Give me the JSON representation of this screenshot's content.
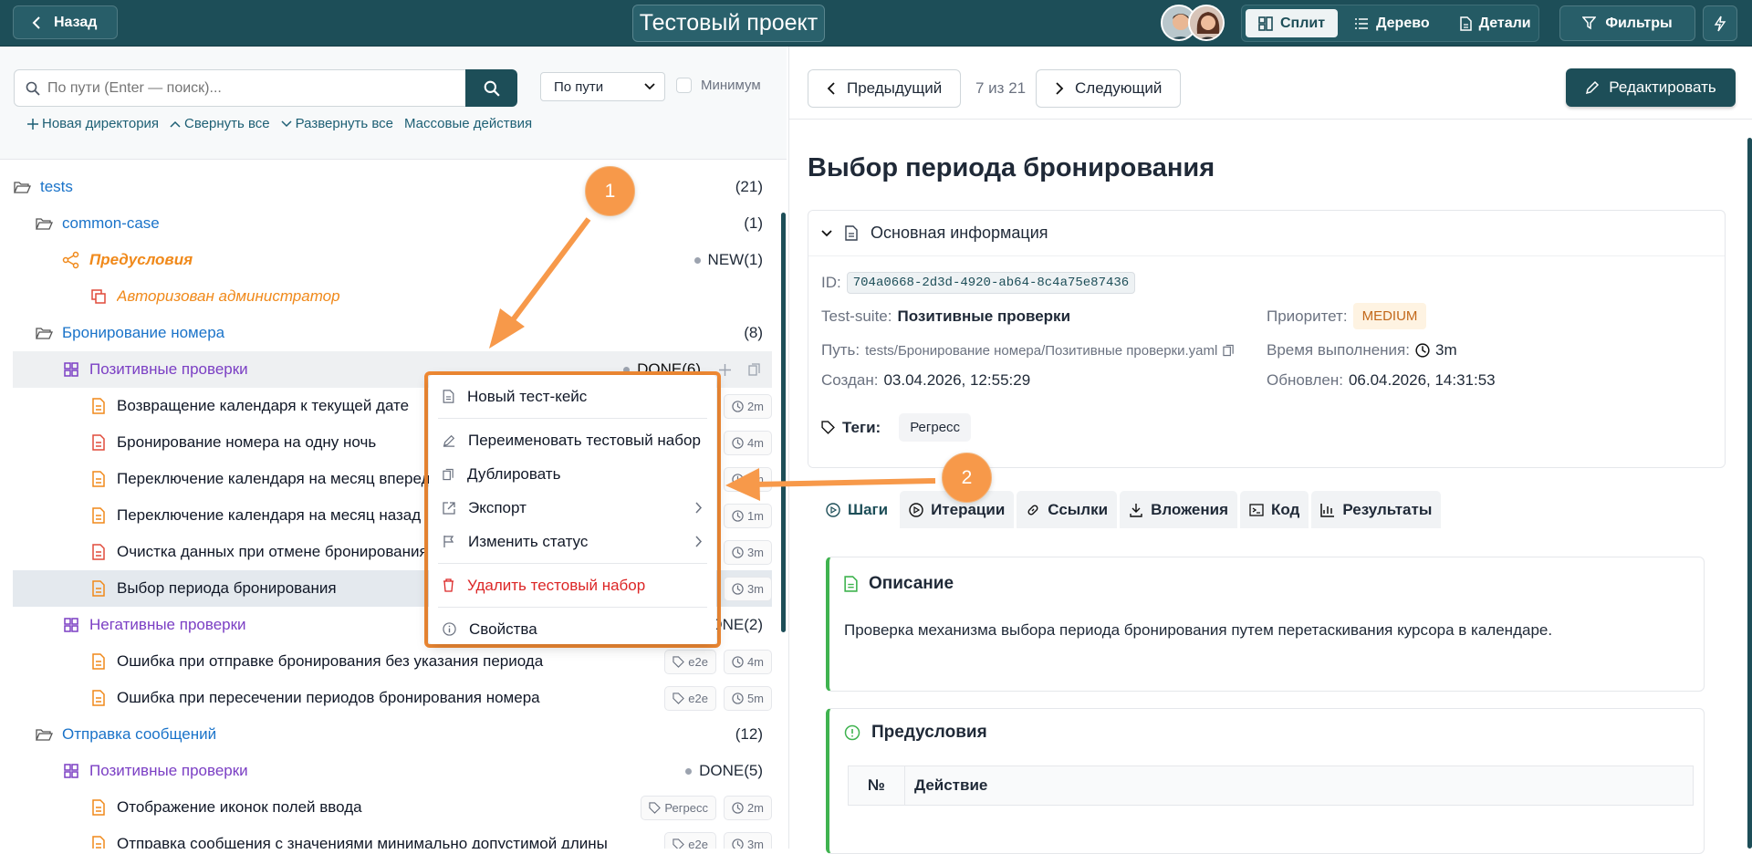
{
  "topbar": {
    "back_label": "Назад",
    "project_title": "Тестовый проект",
    "views": [
      {
        "label": "Сплит",
        "icon": "split-icon",
        "active": true
      },
      {
        "label": "Дерево",
        "icon": "list-icon",
        "active": false
      },
      {
        "label": "Детали",
        "icon": "document-icon",
        "active": false
      }
    ],
    "filters_label": "Фильтры",
    "accent": "#1d4e58"
  },
  "left": {
    "search_placeholder": "По пути (Enter — поиск)...",
    "select_value": "По пути",
    "minimum_label": "Минимум",
    "actions": {
      "new_dir": "Новая директория",
      "collapse_all": "Свернуть все",
      "expand_all": "Развернуть все",
      "bulk": "Массовые действия"
    },
    "tree": [
      {
        "name": "tests",
        "count": "(21)",
        "type": "dir"
      },
      {
        "name": "common-case",
        "count": "(1)",
        "type": "dir"
      },
      {
        "name": "Предусловия",
        "status": "NEW",
        "status_count": "(1)",
        "type": "pre"
      },
      {
        "name": "Авторизован администратор",
        "type": "pre-case"
      },
      {
        "name": "Бронирование номера",
        "count": "(8)",
        "type": "dir"
      },
      {
        "name": "Позитивные проверки",
        "status": "DONE",
        "status_count": "(6)",
        "type": "suite"
      },
      {
        "name": "Возвращение календаря к текущей дате",
        "time": "2m",
        "type": "case"
      },
      {
        "name": "Бронирование номера на одну ночь",
        "time": "4m",
        "type": "case"
      },
      {
        "name": "Переключение календаря на месяц вперед",
        "time": "1m",
        "type": "case"
      },
      {
        "name": "Переключение календаря на месяц назад",
        "time": "1m",
        "type": "case"
      },
      {
        "name": "Очистка данных при отмене бронирования",
        "time": "3m",
        "type": "case"
      },
      {
        "name": "Выбор периода бронирования",
        "time": "3m",
        "type": "case"
      },
      {
        "name": "Негативные проверки",
        "status": "DONE",
        "status_count": "(2)",
        "type": "suite"
      },
      {
        "name": "Ошибка при отправке бронирования без указания периода",
        "tag": "e2e",
        "time": "4m",
        "type": "case"
      },
      {
        "name": "Ошибка при пересечении периодов бронирования номера",
        "tag": "e2e",
        "time": "5m",
        "type": "case"
      },
      {
        "name": "Отправка сообщений",
        "count": "(12)",
        "type": "dir"
      },
      {
        "name": "Позитивные проверки",
        "status": "DONE",
        "status_count": "(5)",
        "type": "suite"
      },
      {
        "name": "Отображение иконок полей ввода",
        "tag": "Регресс",
        "time": "2m",
        "type": "case"
      },
      {
        "name": "Отправка сообщения с значениями минимально допустимой длины",
        "tag": "e2e",
        "time": "3m",
        "type": "case"
      }
    ]
  },
  "context_menu": {
    "new_case": "Новый тест-кейс",
    "rename": "Переименовать тестовый набор",
    "duplicate": "Дублировать",
    "export": "Экспорт",
    "change_status": "Изменить статус",
    "delete": "Удалить тестовый набор",
    "properties": "Свойства"
  },
  "annotations": {
    "badge1": "1",
    "badge2": "2",
    "color": "#f28a33"
  },
  "right": {
    "prev_label": "Предыдущий",
    "position": "7 из 21",
    "next_label": "Следующий",
    "edit_label": "Редактировать",
    "title": "Выбор периода бронирования",
    "info_header": "Основная информация",
    "id_label": "ID:",
    "id_value": "704a0668-2d3d-4920-ab64-8c4a75e87436",
    "suite_label": "Test-suite:",
    "suite_value": "Позитивные проверки",
    "priority_label": "Приоритет:",
    "priority_value": "MEDIUM",
    "path_label": "Путь:",
    "path_value": "tests/Бронирование номера/Позитивные проверки.yaml",
    "duration_label": "Время выполнения:",
    "duration_value": "3m",
    "created_label": "Создан:",
    "created_value": "03.04.2026, 12:55:29",
    "updated_label": "Обновлен:",
    "updated_value": "06.04.2026, 14:31:53",
    "tags_label": "Теги:",
    "tags": [
      "Регресс"
    ],
    "tabs": [
      "Шаги",
      "Итерации",
      "Ссылки",
      "Вложения",
      "Код",
      "Результаты"
    ],
    "desc_title": "Описание",
    "desc_text": "Проверка механизма выбора периода бронирования путем перетаскивания курсора в календаре.",
    "pre_title": "Предусловия",
    "table_cols": [
      "№",
      "Действие"
    ]
  }
}
